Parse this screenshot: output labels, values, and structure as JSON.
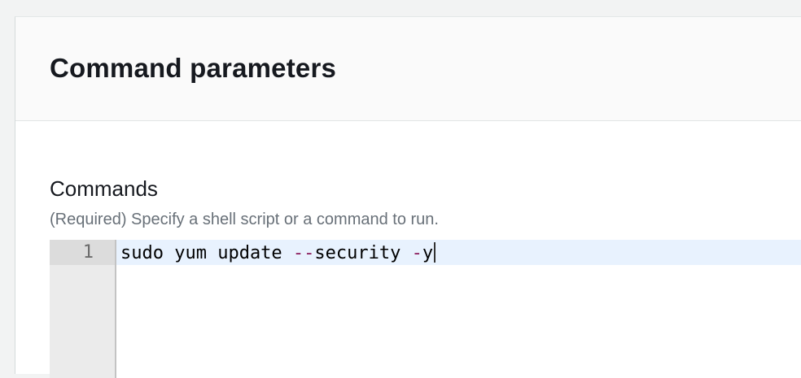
{
  "panel": {
    "title": "Command parameters"
  },
  "commands_field": {
    "label": "Commands",
    "description": "(Required) Specify a shell script or a command to run."
  },
  "editor": {
    "lines": [
      {
        "number": "1",
        "tokens": {
          "t1": "sudo yum update ",
          "t2": "--",
          "t3": "security ",
          "t4": "-",
          "t5": "y"
        }
      }
    ]
  },
  "colors": {
    "operator": "#8a1b5b",
    "active_line": "#e8f2fe",
    "gutter": "#ebebeb"
  }
}
